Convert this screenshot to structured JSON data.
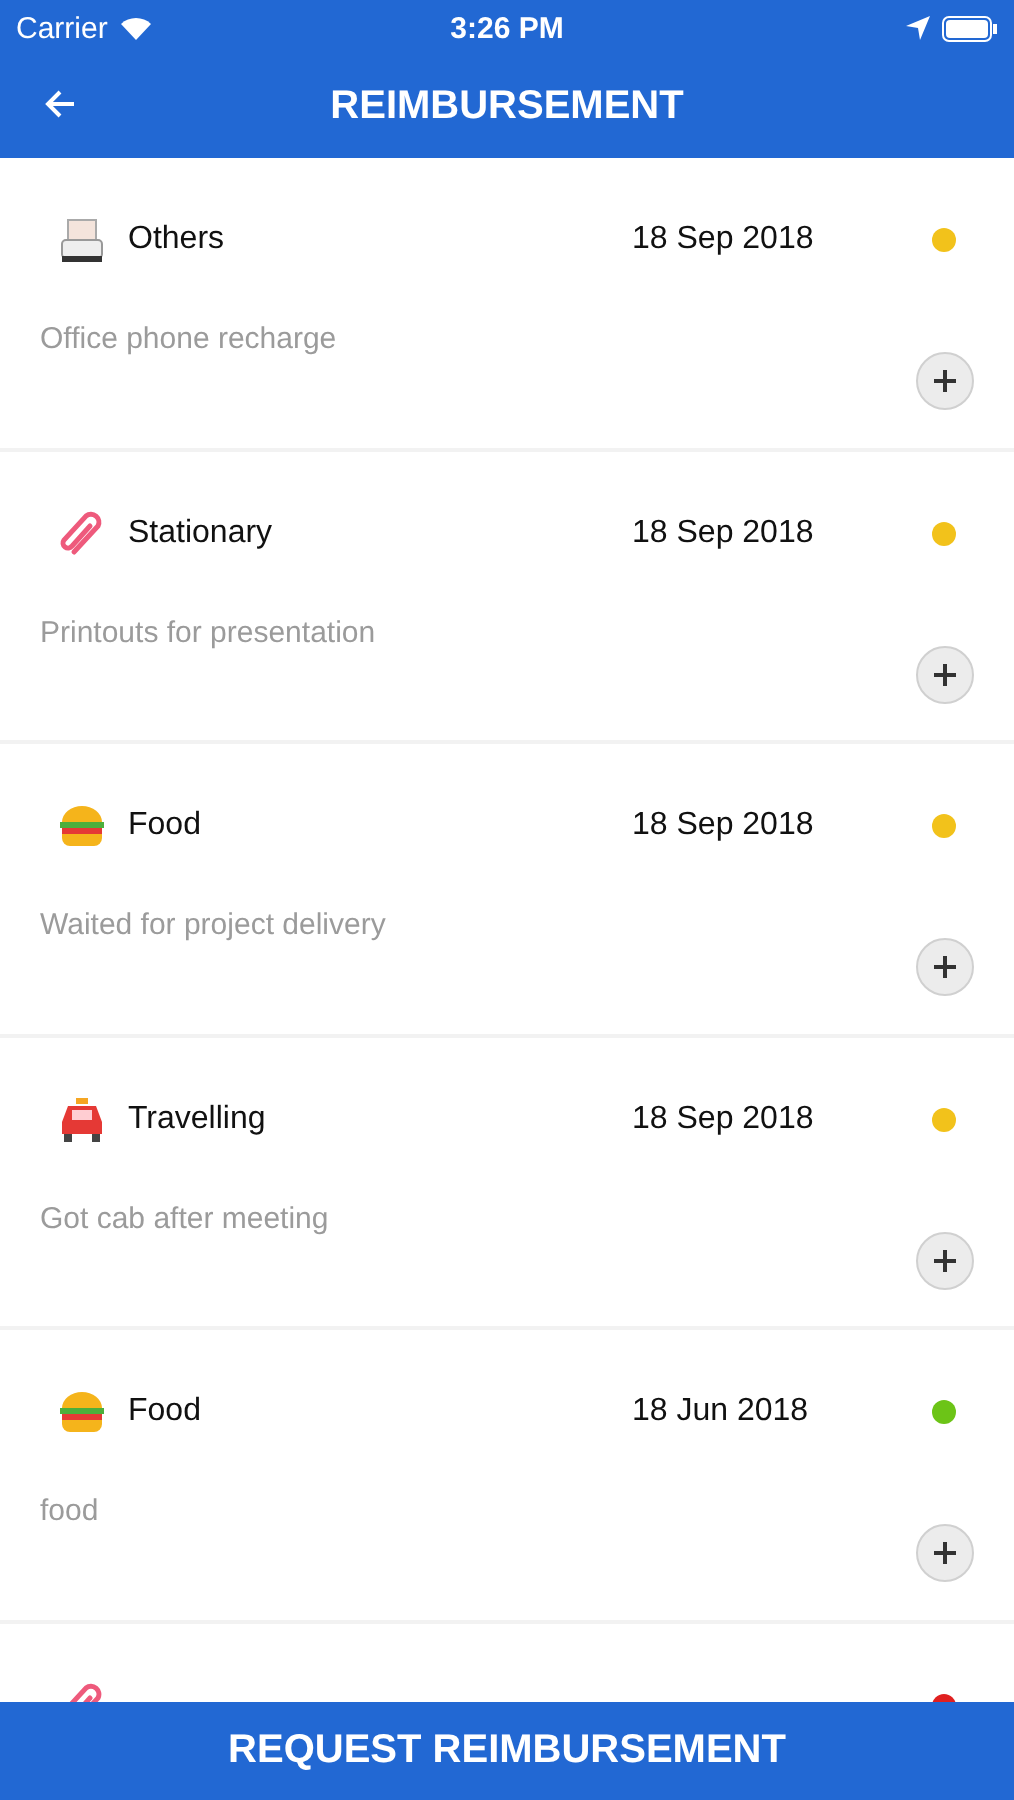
{
  "status_bar": {
    "carrier": "Carrier",
    "time": "3:26 PM"
  },
  "header": {
    "title": "REIMBURSEMENT"
  },
  "claims": [
    {
      "kind": "printer",
      "category": "Others",
      "date": "18 Sep 2018",
      "color": "#f2c21b",
      "description": "Office phone recharge"
    },
    {
      "kind": "paperclip",
      "category": "Stationary",
      "date": "18 Sep 2018",
      "color": "#f2c21b",
      "description": "Printouts for presentation"
    },
    {
      "kind": "burger",
      "category": "Food",
      "date": "18 Sep 2018",
      "color": "#f2c21b",
      "description": "Waited for project delivery"
    },
    {
      "kind": "car",
      "category": "Travelling",
      "date": "18 Sep 2018",
      "color": "#f2c21b",
      "description": "Got cab after meeting"
    },
    {
      "kind": "burger",
      "category": "Food",
      "date": "18 Jun 2018",
      "color": "#6cc417",
      "description": "food"
    },
    {
      "kind": "paperclip",
      "color": "#e02020"
    }
  ],
  "footer_button": {
    "label": "REQUEST REIMBURSEMENT"
  }
}
